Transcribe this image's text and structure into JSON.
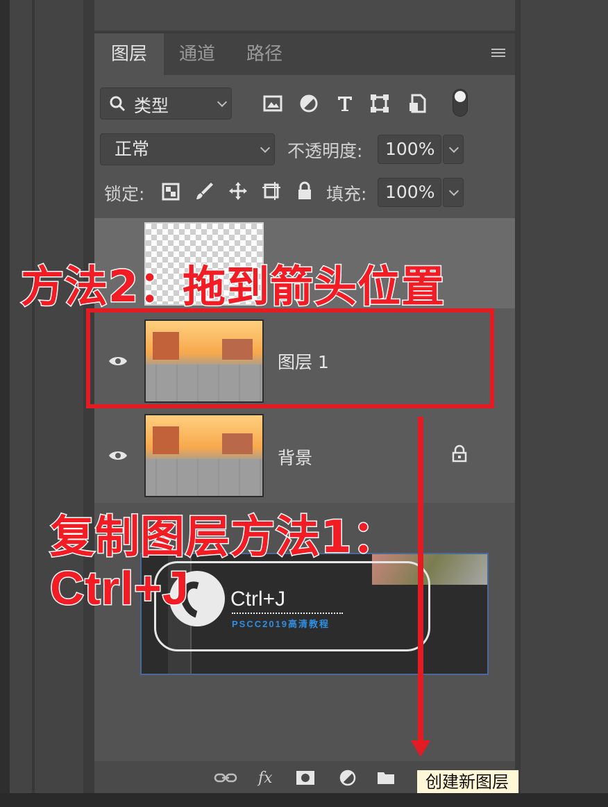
{
  "tabs": [
    {
      "label": "图层",
      "active": true
    },
    {
      "label": "通道",
      "active": false
    },
    {
      "label": "路径",
      "active": false
    }
  ],
  "filter": {
    "label": "类型"
  },
  "blend": {
    "mode": "正常",
    "opacity_label": "不透明度:",
    "opacity_value": "100%"
  },
  "lock": {
    "label": "锁定:",
    "fill_label": "填充:",
    "fill_value": "100%"
  },
  "layers": [
    {
      "name": "",
      "visible": false,
      "thumbnail": "transparent"
    },
    {
      "name": "图层 1",
      "visible": true,
      "thumbnail": "scene"
    },
    {
      "name": "背景",
      "visible": true,
      "thumbnail": "scene",
      "locked": true
    }
  ],
  "toolbar": {
    "tooltip": "创建新图层",
    "fx_label": "fx"
  },
  "annotations": {
    "method2": "方法2：拖到箭头位置",
    "method1_line1": "复制图层方法1：",
    "method1_line2": "Ctrl+J"
  },
  "badge": {
    "title": "Ctrl+J",
    "subtitle": "PSCC2019高清教程"
  },
  "colors": {
    "annotation_red": "#f11c24",
    "panel_bg": "#535353",
    "tab_bg": "#424242"
  }
}
